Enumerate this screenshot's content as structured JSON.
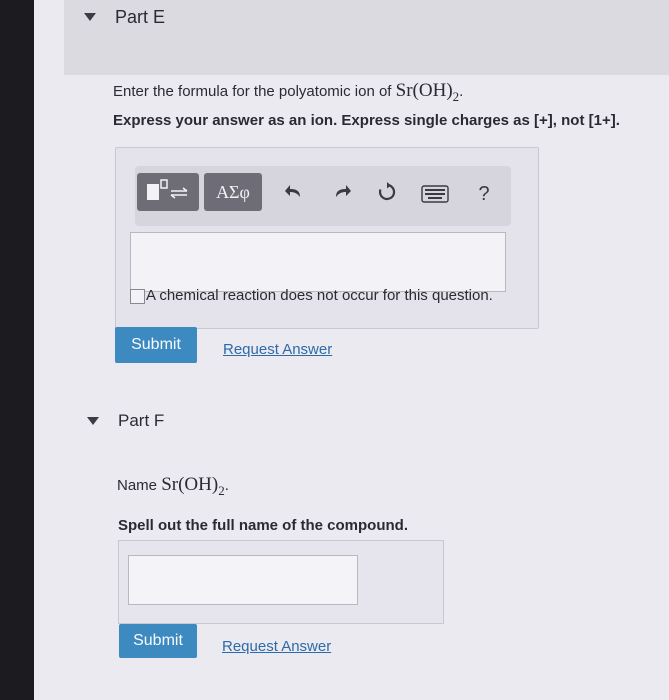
{
  "partE": {
    "title": "Part E",
    "prompt_prefix": "Enter the formula for the polyatomic ion of ",
    "formula_main": "Sr(OH)",
    "formula_sub": "2",
    "formula_dot": ".",
    "instruction": "Express your answer as an ion. Express single charges as [+], not [1+].",
    "toolbar": {
      "greek_label": "ΑΣφ",
      "help_label": "?"
    },
    "checkbox_label": "A chemical reaction does not occur for this question.",
    "submit_label": "Submit",
    "request_label": "Request Answer"
  },
  "partF": {
    "title": "Part F",
    "prompt_prefix": "Name ",
    "formula_main": "Sr(OH)",
    "formula_sub": "2",
    "formula_dot": ".",
    "instruction": "Spell out the full name of the compound.",
    "submit_label": "Submit",
    "request_label": "Request Answer"
  },
  "colors": {
    "submit": "#3d8ac0",
    "link": "#2d6aa8",
    "toolbar_dark": "#6e6d77"
  }
}
